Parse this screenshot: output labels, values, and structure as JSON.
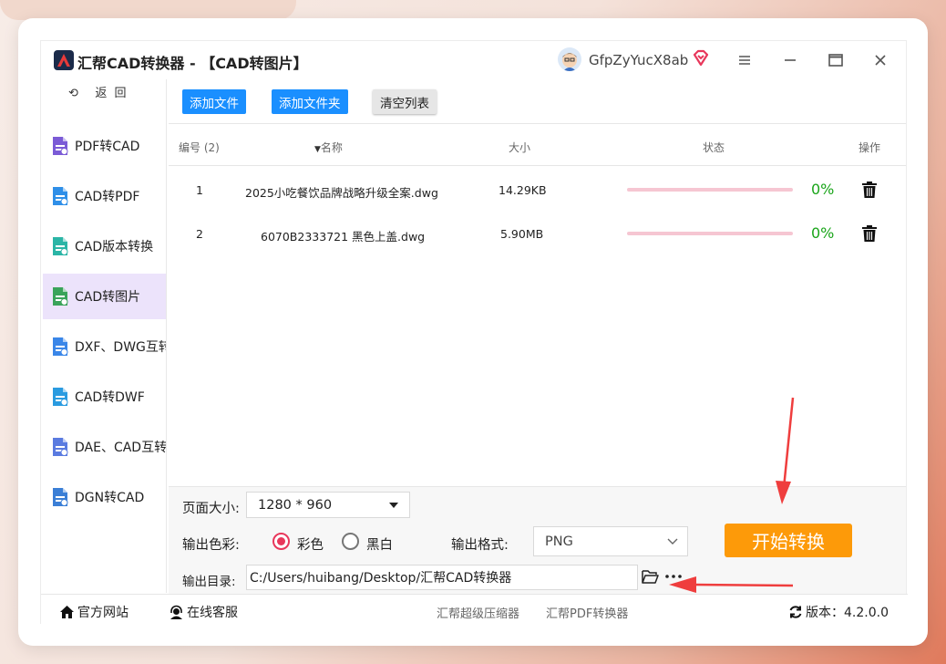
{
  "window": {
    "title": "汇帮CAD转换器 - 【CAD转图片】",
    "username": "GfpZyYucX8ab"
  },
  "sidebar": {
    "back_label": "返 回",
    "items": [
      {
        "label": "PDF转CAD",
        "icon": "pdf-to-cad-icon",
        "active": false
      },
      {
        "label": "CAD转PDF",
        "icon": "cad-to-pdf-icon",
        "active": false
      },
      {
        "label": "CAD版本转换",
        "icon": "cad-version-icon",
        "active": false
      },
      {
        "label": "CAD转图片",
        "icon": "cad-to-image-icon",
        "active": true
      },
      {
        "label": "DXF、DWG互转",
        "icon": "dxf-dwg-icon",
        "active": false
      },
      {
        "label": "CAD转DWF",
        "icon": "cad-to-dwf-icon",
        "active": false
      },
      {
        "label": "DAE、CAD互转",
        "icon": "dae-cad-icon",
        "active": false
      },
      {
        "label": "DGN转CAD",
        "icon": "dgn-to-cad-icon",
        "active": false
      }
    ]
  },
  "toolbar": {
    "add_file": "添加文件",
    "add_folder": "添加文件夹",
    "clear_list": "清空列表"
  },
  "table": {
    "headers": {
      "index": "编号 (2)",
      "name": "名称",
      "size": "大小",
      "status": "状态",
      "action": "操作"
    },
    "rows": [
      {
        "index": "1",
        "name": "2025小吃餐饮品牌战略升级全案.dwg",
        "size": "14.29KB",
        "progress": "0%"
      },
      {
        "index": "2",
        "name": "6070B2333721 黑色上盖.dwg",
        "size": "5.90MB",
        "progress": "0%"
      }
    ]
  },
  "settings": {
    "page_size_label": "页面大小:",
    "page_size_value": "1280 * 960",
    "color_label": "输出色彩:",
    "color_option_1": "彩色",
    "color_option_2": "黑白",
    "color_selected": "彩色",
    "format_label": "输出格式:",
    "format_value": "PNG",
    "dir_label": "输出目录:",
    "dir_value": "C:/Users/huibang/Desktop/汇帮CAD转换器",
    "start_button": "开始转换"
  },
  "footer": {
    "website": "官方网站",
    "service": "在线客服",
    "link_1": "汇帮超级压缩器",
    "link_2": "汇帮PDF转换器",
    "version": "版本：4.2.0.0"
  },
  "colors": {
    "accent_blue": "#1a8fff",
    "start_orange": "#fd9a09",
    "active_sidebar": "#ece3fb",
    "progress_pink": "#f6c6d2",
    "success_green": "#1aa51a",
    "annotation_red": "#ef3e3e"
  }
}
